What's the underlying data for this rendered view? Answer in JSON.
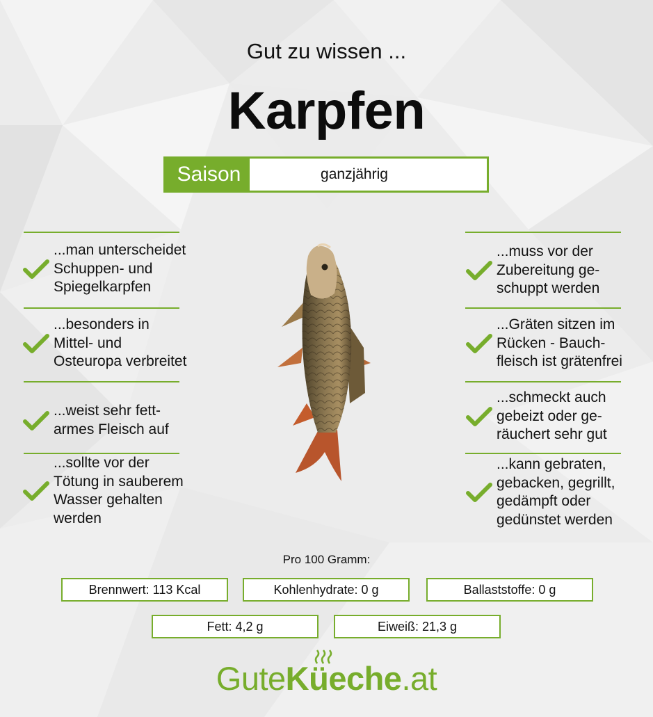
{
  "header": {
    "subtitle": "Gut zu wissen ...",
    "title": "Karpfen"
  },
  "season": {
    "label": "Saison",
    "value": "ganzjährig"
  },
  "facts_left": [
    "...man unterscheidet\nSchuppen- und\nSpiegelkarpfen",
    "...besonders in\nMittel- und\nOsteuropa verbreitet",
    "...weist sehr fett-\narmes Fleisch auf",
    "...sollte vor der\nTötung in sauberem\nWasser gehalten\nwerden"
  ],
  "facts_right": [
    "...muss vor der\nZubereitung ge-\nschuppt werden",
    "...Gräten sitzen im\nRücken - Bauch-\nfleisch ist grätenfrei",
    "...schmeckt auch\ngebeizt oder ge-\nräuchert sehr gut",
    "...kann gebraten,\ngebacken, gegrillt,\ngedämpft oder\ngedünstet werden"
  ],
  "nutrition": {
    "title": "Pro 100 Gramm:",
    "items": [
      "Brennwert: 113 Kcal",
      "Kohlenhydrate: 0 g",
      "Ballaststoffe: 0 g",
      "Fett: 4,2 g",
      "Eiweiß: 21,3 g"
    ]
  },
  "logo": {
    "part1": "Gute",
    "part2": "Küeche",
    "part3": ".at"
  },
  "colors": {
    "accent": "#77ad2c",
    "background": "#ececec",
    "text": "#111111"
  },
  "icons": [
    "check-icon",
    "carp-fish-image",
    "steam-icon"
  ]
}
